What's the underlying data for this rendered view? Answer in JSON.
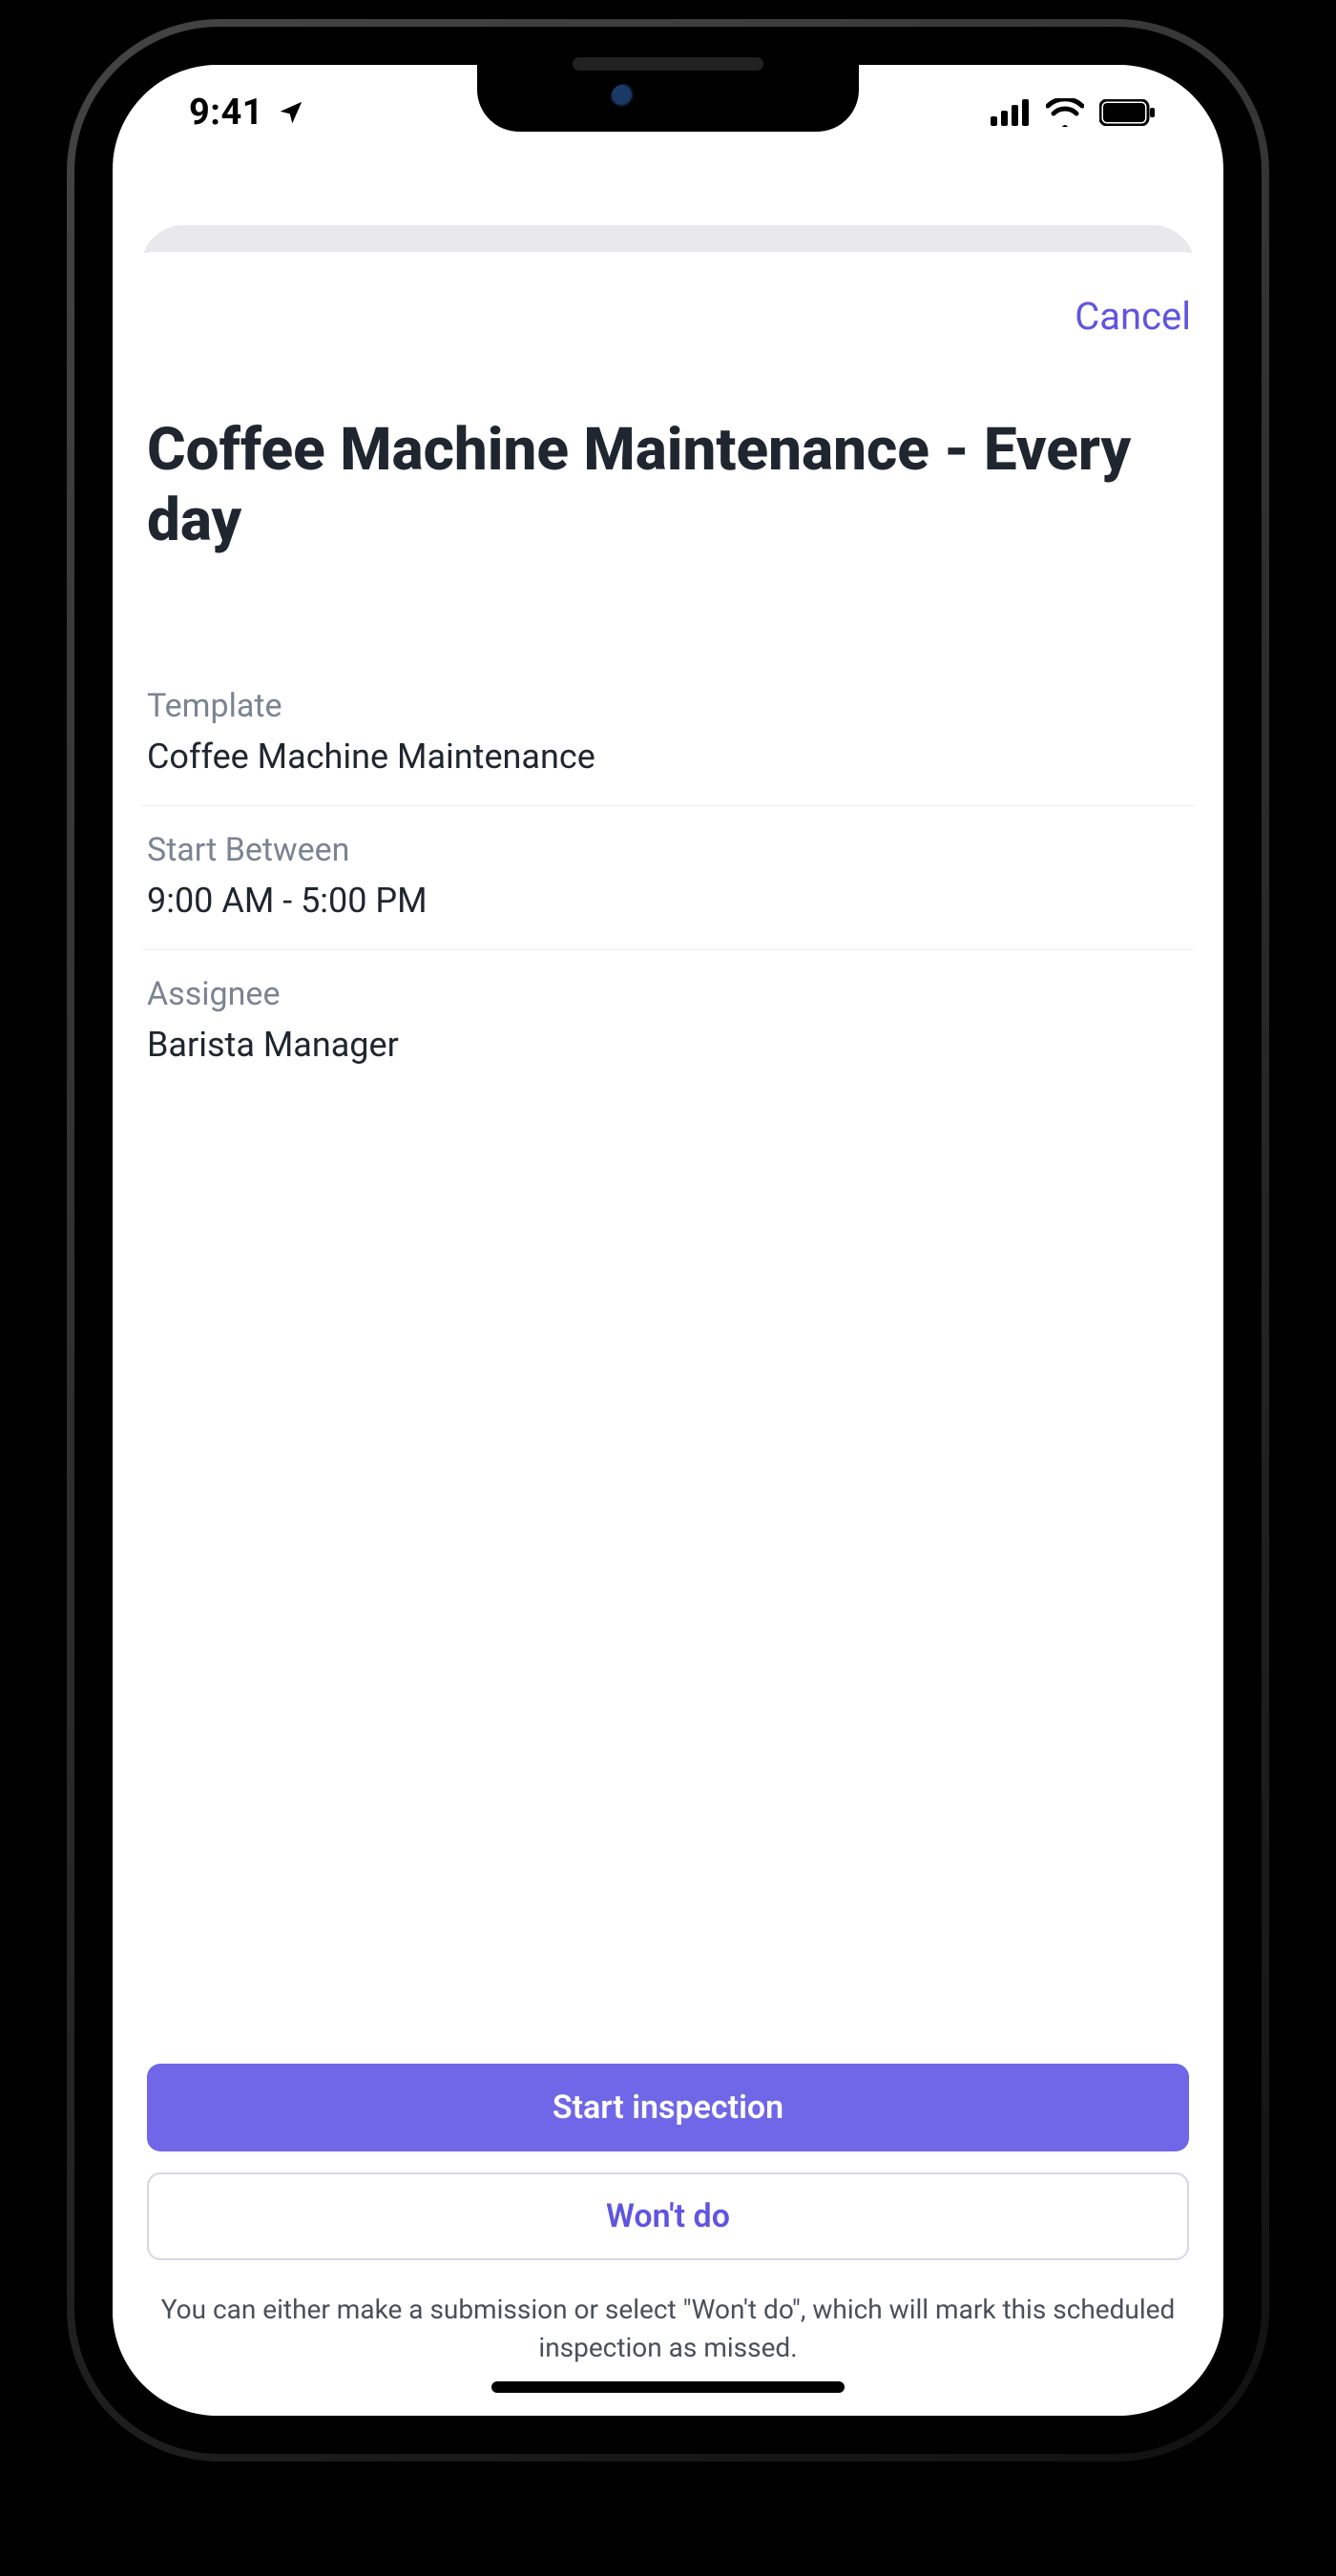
{
  "statusbar": {
    "time": "9:41",
    "location_icon": "location-arrow",
    "cellular_icon": "cellular-bars",
    "wifi_icon": "wifi",
    "battery_icon": "battery-full"
  },
  "sheet": {
    "cancel_label": "Cancel",
    "title": "Coffee Machine Maintenance - Every day",
    "fields": [
      {
        "label": "Template",
        "value": "Coffee Machine Maintenance"
      },
      {
        "label": "Start Between",
        "value": "9:00 AM - 5:00 PM"
      },
      {
        "label": "Assignee",
        "value": "Barista Manager"
      }
    ],
    "primary_button": "Start inspection",
    "secondary_button": "Won't do",
    "footnote": "You can either make a submission or select \"Won't do\", which will mark this scheduled inspection as missed."
  }
}
